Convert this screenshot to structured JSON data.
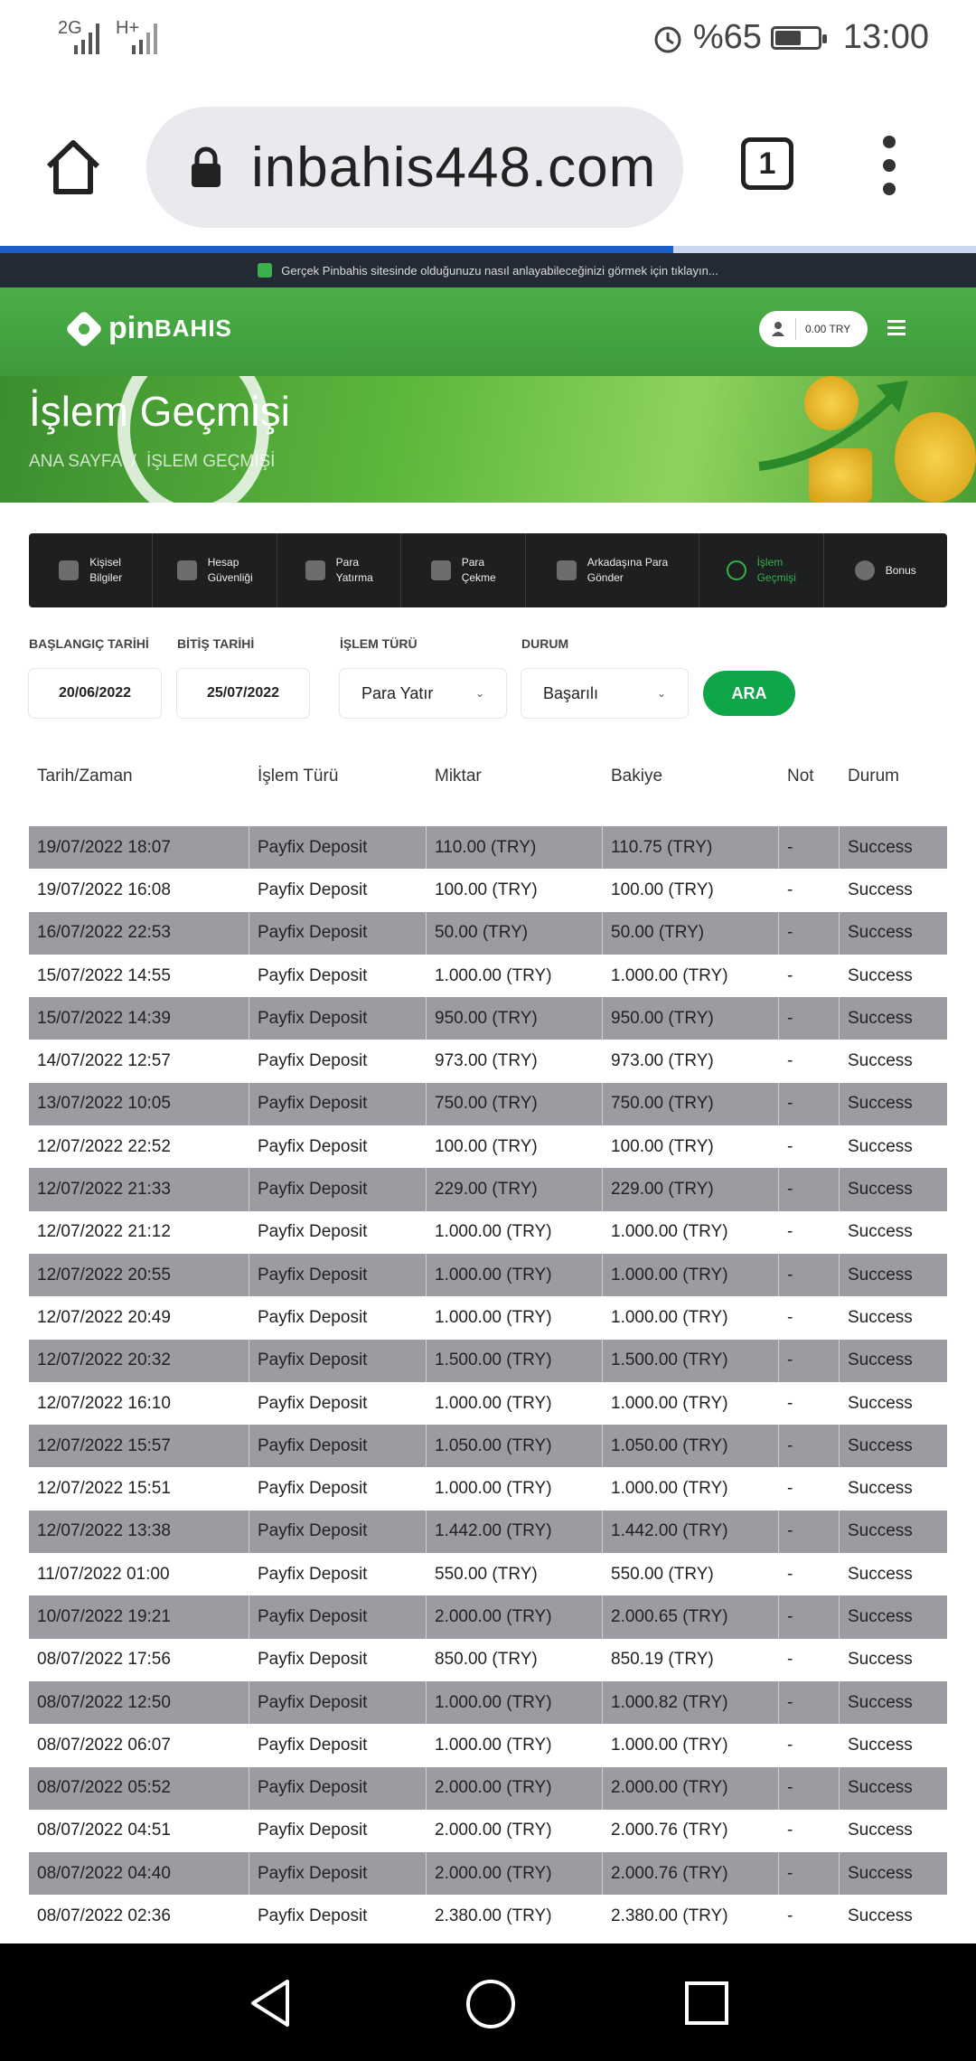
{
  "status_bar": {
    "signal_1": "2G",
    "signal_2": "H+",
    "battery_text": "%65",
    "battery_level": 0.65,
    "time": "13:00"
  },
  "browser": {
    "url": "inbahis448.com",
    "tab_count": "1",
    "load_progress": 0.69
  },
  "notice": {
    "text": "Gerçek Pinbahis sitesinde olduğunuzu nasıl anlayabileceğinizi görmek için tıklayın..."
  },
  "header": {
    "logo_pin": "pin",
    "logo_bahis": "BAHIS",
    "balance": "0.00 TRY",
    "brand_color": "#4cae48"
  },
  "hero": {
    "title": "İşlem Geçmişi",
    "breadcrumb_home": "ANA SAYFA",
    "breadcrumb_sep": "/",
    "breadcrumb_current": "İŞLEM GEÇMİŞİ"
  },
  "profile_tabs": [
    {
      "line1": "Kişisel",
      "line2": "Bilgiler",
      "icon": "user-icon"
    },
    {
      "line1": "Hesap",
      "line2": "Güvenliği",
      "icon": "shield-icon"
    },
    {
      "line1": "Para",
      "line2": "Yatırma",
      "icon": "wallet-icon"
    },
    {
      "line1": "Para",
      "line2": "Çekme",
      "icon": "withdraw-icon"
    },
    {
      "line1": "Arkadaşına Para",
      "line2": "Gönder",
      "icon": "transfer-icon"
    },
    {
      "line1": "İşlem",
      "line2": "Geçmişi",
      "icon": "history-icon",
      "active": true
    },
    {
      "line1": "Bonus",
      "line2": "",
      "icon": "smile-icon"
    }
  ],
  "filters": {
    "start_label": "BAŞLANGIÇ TARİHİ",
    "start_value": "20/06/2022",
    "end_label": "BİTİŞ TARİHİ",
    "end_value": "25/07/2022",
    "type_label": "İŞLEM TÜRÜ",
    "type_value": "Para Yatır",
    "status_label": "DURUM",
    "status_value": "Başarılı",
    "search_button": "ARA",
    "accent_color": "#0fa64a"
  },
  "table": {
    "headers": [
      "Tarih/Zaman",
      "İşlem Türü",
      "Miktar",
      "Bakiye",
      "Not",
      "Durum"
    ],
    "rows": [
      [
        "19/07/2022 18:07",
        "Payfix Deposit",
        "110.00 (TRY)",
        "110.75 (TRY)",
        "-",
        "Success"
      ],
      [
        "19/07/2022 16:08",
        "Payfix Deposit",
        "100.00 (TRY)",
        "100.00 (TRY)",
        "-",
        "Success"
      ],
      [
        "16/07/2022 22:53",
        "Payfix Deposit",
        "50.00 (TRY)",
        "50.00 (TRY)",
        "-",
        "Success"
      ],
      [
        "15/07/2022 14:55",
        "Payfix Deposit",
        "1.000.00 (TRY)",
        "1.000.00 (TRY)",
        "-",
        "Success"
      ],
      [
        "15/07/2022 14:39",
        "Payfix Deposit",
        "950.00 (TRY)",
        "950.00 (TRY)",
        "-",
        "Success"
      ],
      [
        "14/07/2022 12:57",
        "Payfix Deposit",
        "973.00 (TRY)",
        "973.00 (TRY)",
        "-",
        "Success"
      ],
      [
        "13/07/2022 10:05",
        "Payfix Deposit",
        "750.00 (TRY)",
        "750.00 (TRY)",
        "-",
        "Success"
      ],
      [
        "12/07/2022 22:52",
        "Payfix Deposit",
        "100.00 (TRY)",
        "100.00 (TRY)",
        "-",
        "Success"
      ],
      [
        "12/07/2022 21:33",
        "Payfix Deposit",
        "229.00 (TRY)",
        "229.00 (TRY)",
        "-",
        "Success"
      ],
      [
        "12/07/2022 21:12",
        "Payfix Deposit",
        "1.000.00 (TRY)",
        "1.000.00 (TRY)",
        "-",
        "Success"
      ],
      [
        "12/07/2022 20:55",
        "Payfix Deposit",
        "1.000.00 (TRY)",
        "1.000.00 (TRY)",
        "-",
        "Success"
      ],
      [
        "12/07/2022 20:49",
        "Payfix Deposit",
        "1.000.00 (TRY)",
        "1.000.00 (TRY)",
        "-",
        "Success"
      ],
      [
        "12/07/2022 20:32",
        "Payfix Deposit",
        "1.500.00 (TRY)",
        "1.500.00 (TRY)",
        "-",
        "Success"
      ],
      [
        "12/07/2022 16:10",
        "Payfix Deposit",
        "1.000.00 (TRY)",
        "1.000.00 (TRY)",
        "-",
        "Success"
      ],
      [
        "12/07/2022 15:57",
        "Payfix Deposit",
        "1.050.00 (TRY)",
        "1.050.00 (TRY)",
        "-",
        "Success"
      ],
      [
        "12/07/2022 15:51",
        "Payfix Deposit",
        "1.000.00 (TRY)",
        "1.000.00 (TRY)",
        "-",
        "Success"
      ],
      [
        "12/07/2022 13:38",
        "Payfix Deposit",
        "1.442.00 (TRY)",
        "1.442.00 (TRY)",
        "-",
        "Success"
      ],
      [
        "11/07/2022 01:00",
        "Payfix Deposit",
        "550.00 (TRY)",
        "550.00 (TRY)",
        "-",
        "Success"
      ],
      [
        "10/07/2022 19:21",
        "Payfix Deposit",
        "2.000.00 (TRY)",
        "2.000.65 (TRY)",
        "-",
        "Success"
      ],
      [
        "08/07/2022 17:56",
        "Payfix Deposit",
        "850.00 (TRY)",
        "850.19 (TRY)",
        "-",
        "Success"
      ],
      [
        "08/07/2022 12:50",
        "Payfix Deposit",
        "1.000.00 (TRY)",
        "1.000.82 (TRY)",
        "-",
        "Success"
      ],
      [
        "08/07/2022 06:07",
        "Payfix Deposit",
        "1.000.00 (TRY)",
        "1.000.00 (TRY)",
        "-",
        "Success"
      ],
      [
        "08/07/2022 05:52",
        "Payfix Deposit",
        "2.000.00 (TRY)",
        "2.000.00 (TRY)",
        "-",
        "Success"
      ],
      [
        "08/07/2022 04:51",
        "Payfix Deposit",
        "2.000.00 (TRY)",
        "2.000.76 (TRY)",
        "-",
        "Success"
      ],
      [
        "08/07/2022 04:40",
        "Payfix Deposit",
        "2.000.00 (TRY)",
        "2.000.76 (TRY)",
        "-",
        "Success"
      ],
      [
        "08/07/2022 02:36",
        "Payfix Deposit",
        "2.380.00 (TRY)",
        "2.380.00 (TRY)",
        "-",
        "Success"
      ]
    ]
  }
}
